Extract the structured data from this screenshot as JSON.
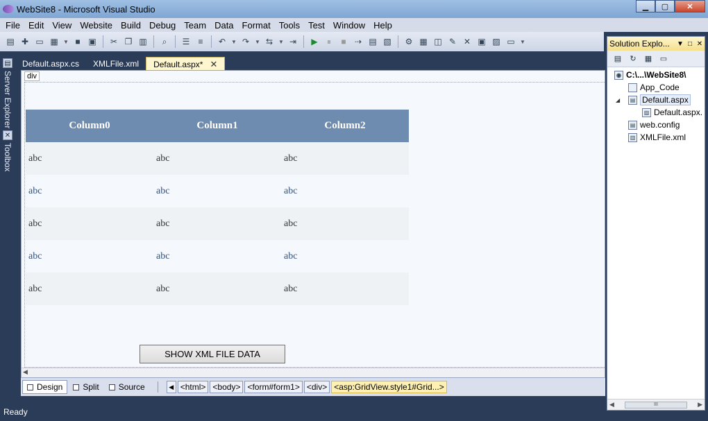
{
  "window": {
    "title": "WebSite8 - Microsoft Visual Studio",
    "controls": {
      "minimize": "▁",
      "maximize": "▢",
      "close": "✕"
    }
  },
  "menu": [
    "File",
    "Edit",
    "View",
    "Website",
    "Build",
    "Debug",
    "Team",
    "Data",
    "Format",
    "Tools",
    "Test",
    "Window",
    "Help"
  ],
  "toolbar": {
    "icons": [
      "new-project-icon",
      "add-item-icon",
      "open-icon",
      "add-icon",
      "save-icon",
      "save-all-icon",
      "cut-icon",
      "copy-icon",
      "paste-icon",
      "find-icon",
      "indent-icon",
      "outdent-icon",
      "undo-icon",
      "redo-icon",
      "navigate-icon",
      "start-icon",
      "pause-icon",
      "stop-icon",
      "step-icon",
      "properties-icon",
      "solution-explorer-icon",
      "toolbox-icon",
      "object-browser-icon"
    ]
  },
  "rail": {
    "server_explorer": "Server Explorer",
    "toolbox": "Toolbox"
  },
  "tabs": [
    {
      "label": "Default.aspx.cs"
    },
    {
      "label": "XMLFile.xml"
    },
    {
      "label": "Default.aspx*"
    }
  ],
  "designer": {
    "div_tag": "div",
    "grid": {
      "headers": [
        "Column0",
        "Column1",
        "Column2"
      ],
      "rows": [
        [
          "abc",
          "abc",
          "abc"
        ],
        [
          "abc",
          "abc",
          "abc"
        ],
        [
          "abc",
          "abc",
          "abc"
        ],
        [
          "abc",
          "abc",
          "abc"
        ],
        [
          "abc",
          "abc",
          "abc"
        ]
      ]
    },
    "button_label": "SHOW XML FILE DATA"
  },
  "view_bar": {
    "design": "Design",
    "split": "Split",
    "source": "Source",
    "tags": [
      "<html>",
      "<body>",
      "<form#form1>",
      "<div>"
    ],
    "current_tag": "<asp:GridView.style1#Grid...>"
  },
  "solution_explorer": {
    "title": "Solution Explo...",
    "items": [
      {
        "label": "C:\\...\\WebSite8\\",
        "bold": true
      },
      {
        "label": "App_Code"
      },
      {
        "label": "Default.aspx"
      },
      {
        "label": "Default.aspx."
      },
      {
        "label": "web.config"
      },
      {
        "label": "XMLFile.xml"
      }
    ],
    "scroll_thumb": "III"
  },
  "status": "Ready"
}
